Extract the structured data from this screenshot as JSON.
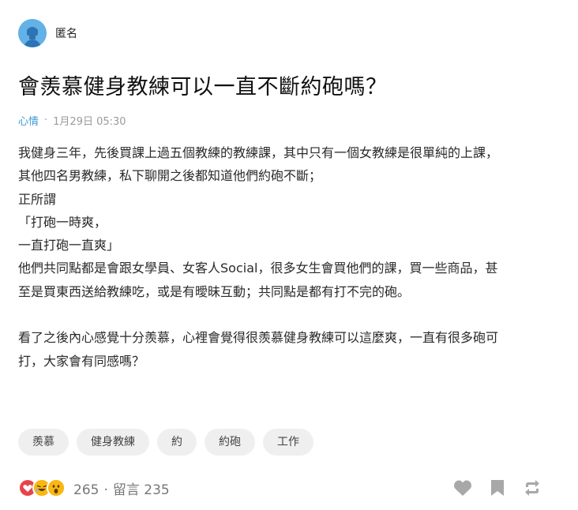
{
  "author": {
    "name": "匿名",
    "avatar_icon": "anonymous-avatar-icon",
    "avatar_color": "#62b2e8"
  },
  "post": {
    "title": "會羨慕健身教練可以一直不斷約砲嗎？",
    "forum": "心情",
    "meta_separator": "·",
    "datetime": "1月29日 05:30",
    "content_lines": [
      "我健身三年，先後買課上過五個教練的教練課，其中只有一個女教練是很單純的上課，",
      "其他四名男教練，私下聊開之後都知道他們約砲不斷；",
      "正所謂",
      "「打砲一時爽，",
      "一直打砲一直爽」",
      "他們共同點都是會跟女學員、女客人Social，很多女生會買他們的課，買一些商品，甚",
      "至是買東西送給教練吃，或是有曖昧互動；共同點是都有打不完的砲。",
      "",
      "看了之後內心感覺十分羨慕，心裡會覺得很羨慕健身教練可以這麼爽，一直有很多砲可",
      "打，大家會有同感嗎？"
    ]
  },
  "tags": [
    "羨慕",
    "健身教練",
    "約",
    "約砲",
    "工作"
  ],
  "footer": {
    "reaction_icons": [
      "heart-emoji-icon",
      "laugh-emoji-icon",
      "wow-emoji-icon"
    ],
    "reaction_count": "265",
    "separator": "·",
    "comment_label": "留言 235",
    "actions": [
      "heart-icon",
      "bookmark-icon",
      "share-icon"
    ]
  },
  "colors": {
    "accent": "#3e9bd6",
    "heart_red": "#e8434b",
    "emoji_yellow": "#f9b712",
    "icon_gray": "#a8a8a8"
  }
}
